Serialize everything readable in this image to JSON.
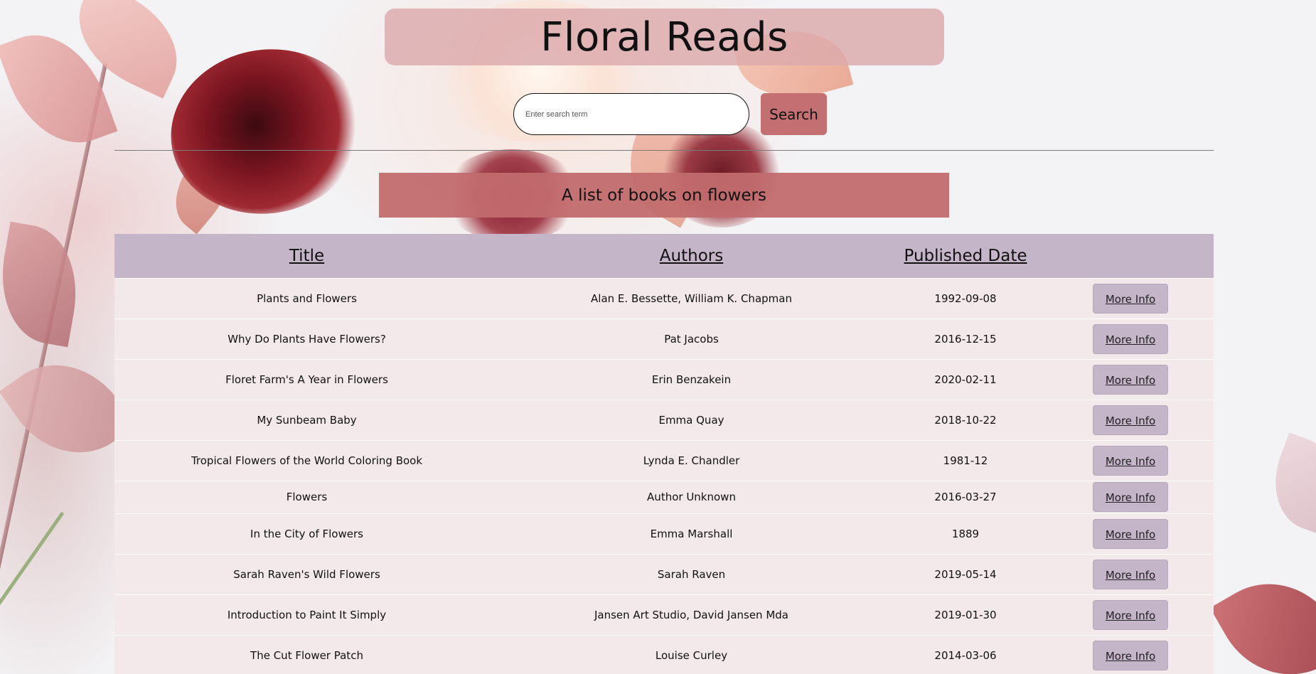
{
  "header": {
    "title": "Floral Reads"
  },
  "search": {
    "placeholder": "Enter search term",
    "value": "",
    "button_label": "Search"
  },
  "subtitle": "A list of books on flowers",
  "table": {
    "columns": [
      "Title",
      "Authors",
      "Published Date"
    ],
    "action_label": "More Info",
    "rows": [
      {
        "title": "Plants and Flowers",
        "authors": "Alan E. Bessette, William K. Chapman",
        "date": "1992-09-08"
      },
      {
        "title": "Why Do Plants Have Flowers?",
        "authors": "Pat Jacobs",
        "date": "2016-12-15"
      },
      {
        "title": "Floret Farm's A Year in Flowers",
        "authors": "Erin Benzakein",
        "date": "2020-02-11"
      },
      {
        "title": "My Sunbeam Baby",
        "authors": "Emma Quay",
        "date": "2018-10-22"
      },
      {
        "title": "Tropical Flowers of the World Coloring Book",
        "authors": "Lynda E. Chandler",
        "date": "1981-12"
      },
      {
        "title": "Flowers",
        "authors": "Author Unknown",
        "date": "2016-03-27"
      },
      {
        "title": "In the City of Flowers",
        "authors": "Emma Marshall",
        "date": "1889"
      },
      {
        "title": "Sarah Raven's Wild Flowers",
        "authors": "Sarah Raven",
        "date": "2019-05-14"
      },
      {
        "title": "Introduction to Paint It Simply",
        "authors": "Jansen Art Studio, David Jansen Mda",
        "date": "2019-01-30"
      },
      {
        "title": "The Cut Flower Patch",
        "authors": "Louise Curley",
        "date": "2014-03-06"
      }
    ]
  },
  "colors": {
    "title_banner": "#dcaaac",
    "subtitle_banner": "#c26b6e",
    "search_button": "#c46f72",
    "table_header": "#c4b5c8",
    "table_row": "#f3e9ea",
    "more_info_button": "#c4b5c8"
  }
}
